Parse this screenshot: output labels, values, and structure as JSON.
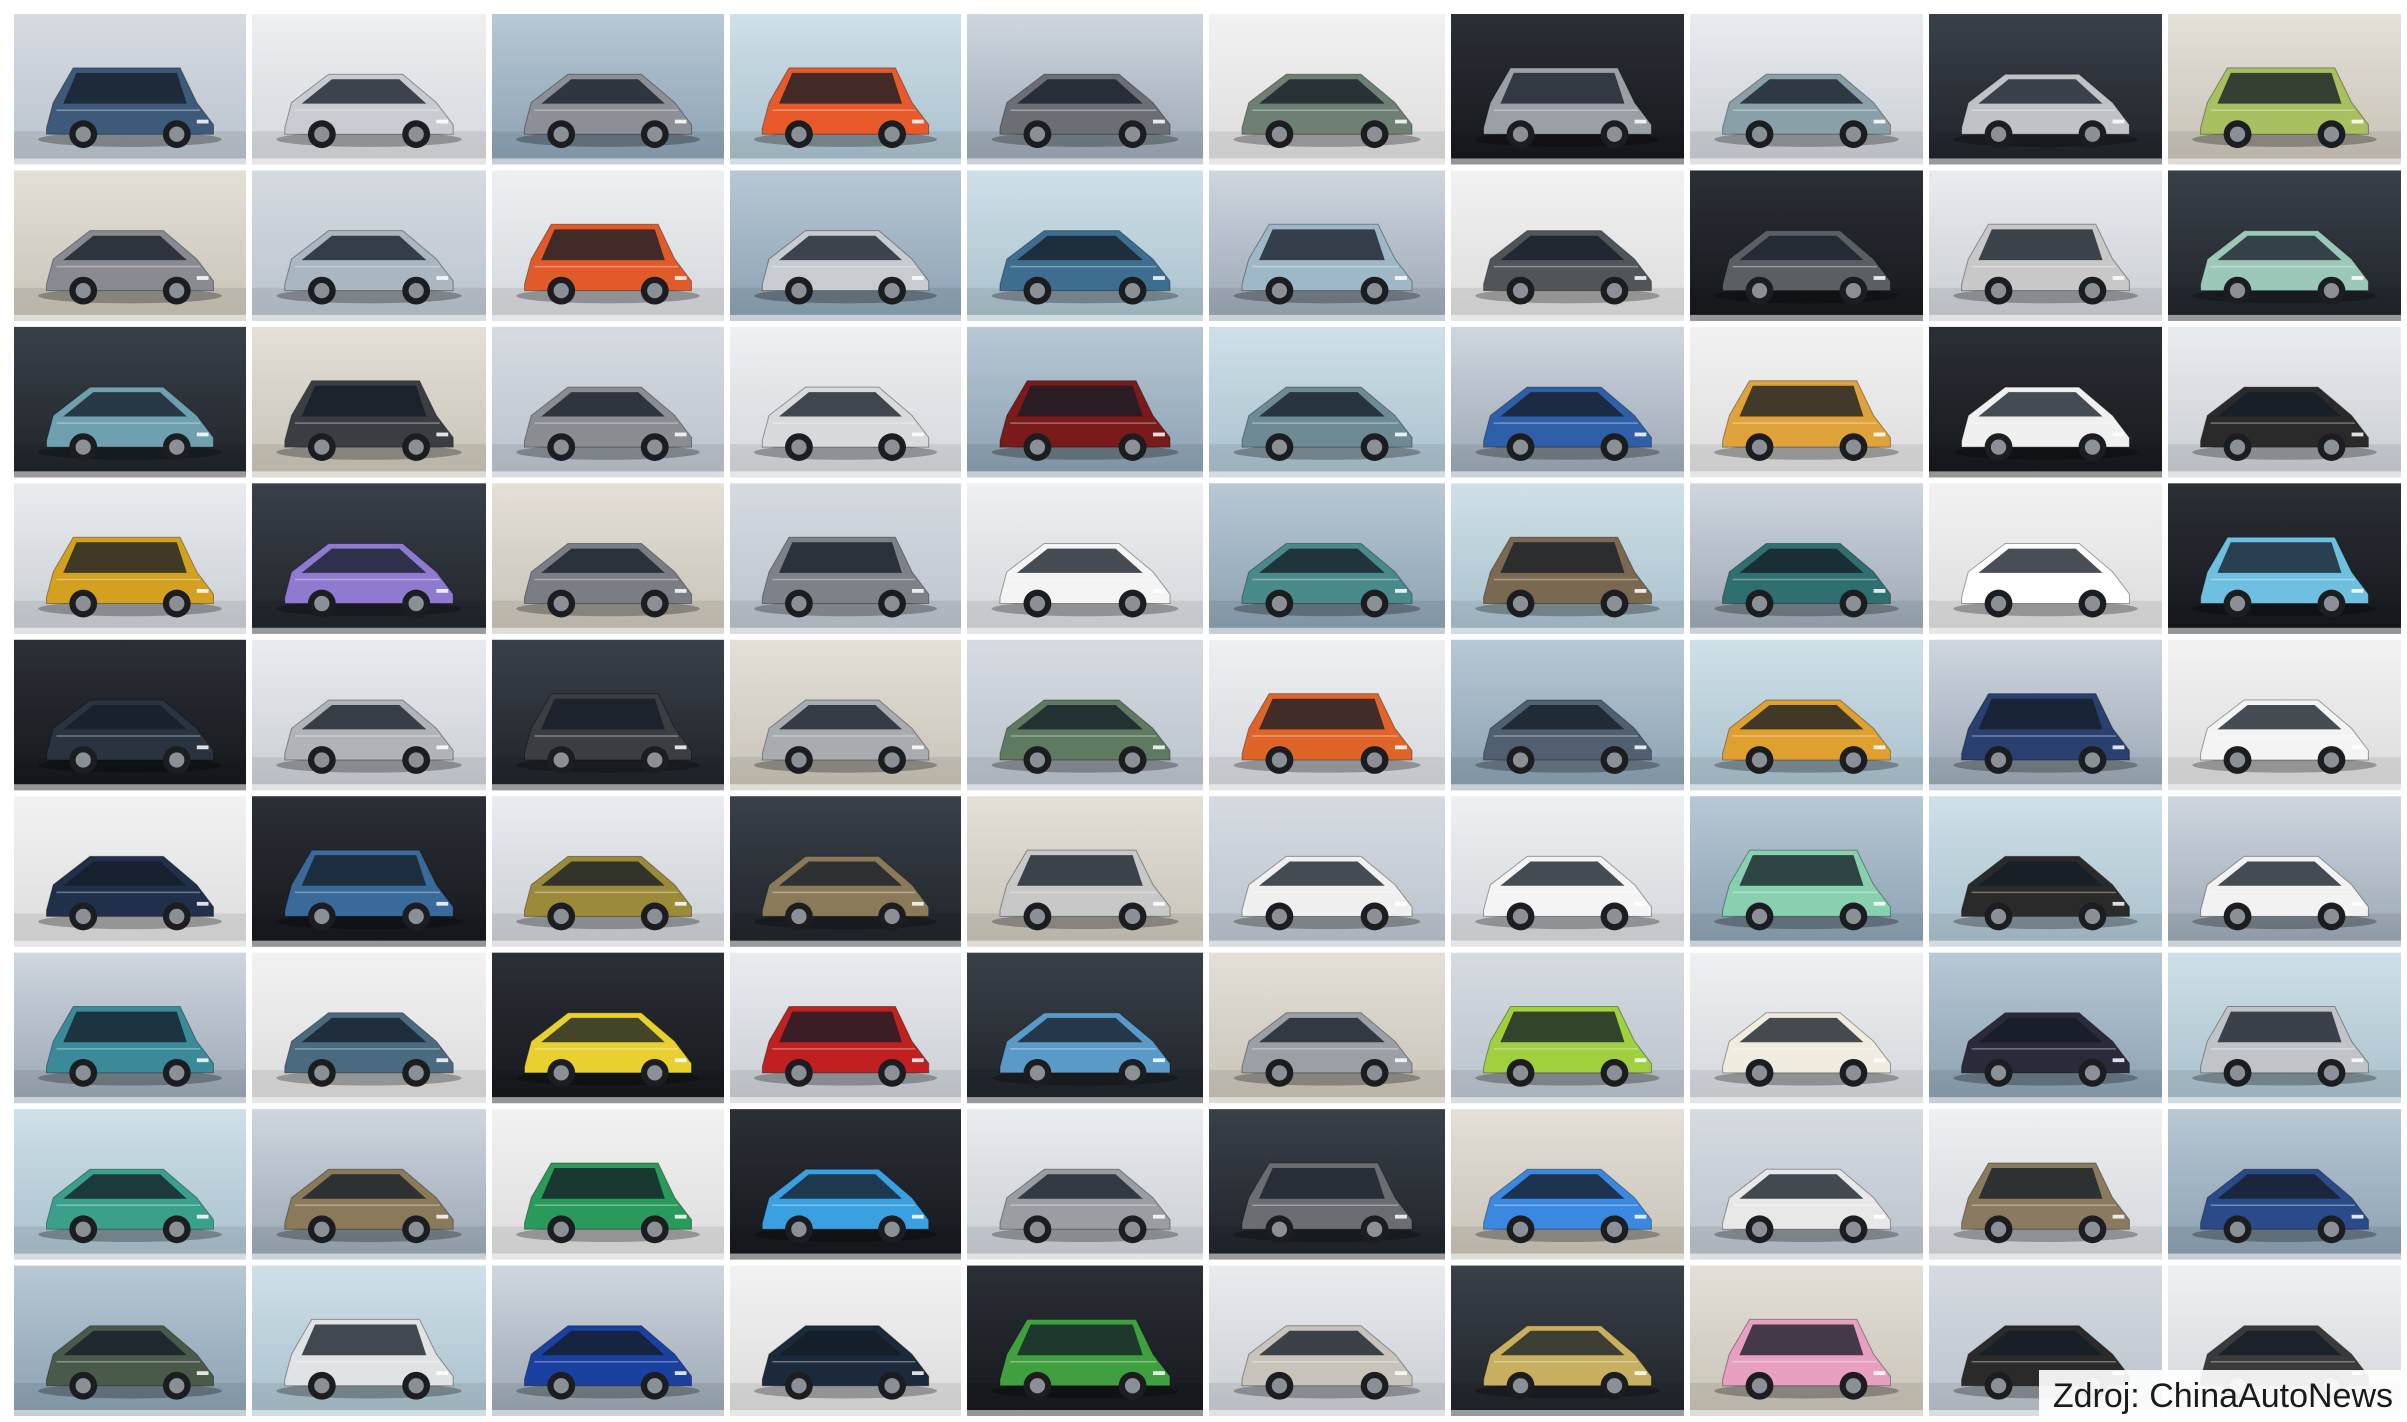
{
  "credit": {
    "text": "Zdroj: ChinaAutoNews"
  },
  "palette": {
    "page_background": "#ffffff",
    "divider": "#ffffff",
    "credit_background": "#ffffff",
    "credit_text": "#1a1a1a"
  },
  "photos": {
    "subject": "car-photo",
    "columns": 10,
    "rows": 9,
    "car_colors": [
      "#3d5a7a",
      "#c8ccd2",
      "#8c9096",
      "#e85a2a",
      "#6b6f75",
      "#6e7f73",
      "#9aa0a6",
      "#8aa0a8",
      "#bfc3c7",
      "#a8c060",
      "#8a8a92",
      "#aab6c0",
      "#e05a2a",
      "#c8ccd0",
      "#3d6d8f",
      "#9fb8c8",
      "#50555a",
      "#5a5f64",
      "#c8c8c8",
      "#9bc8b8",
      "#6fa0b0",
      "#3a3d42",
      "#8a8d92",
      "#d8dadc",
      "#7a1a1a",
      "#6d8a95",
      "#2f5fa8",
      "#e0a23a",
      "#f0f0f0",
      "#2a2a2a",
      "#d4a020",
      "#8f7ad0",
      "#7a7e84",
      "#7d8288",
      "#f4f4f4",
      "#4a8a8a",
      "#7a6850",
      "#2f6f6f",
      "#ffffff",
      "#6fc0e0",
      "#2a3440",
      "#b0b4b8",
      "#3a3d42",
      "#a8acb0",
      "#5e7a60",
      "#e0642a",
      "#506070",
      "#e0a030",
      "#2a4070",
      "#f4f4f4",
      "#20304a",
      "#3a6a9a",
      "#9a8a3a",
      "#8a7a5a",
      "#c8c8c8",
      "#f0f0f0",
      "#f4f4f4",
      "#88d0b0",
      "#2a2a2a",
      "#f2f2f2",
      "#3a8a9a",
      "#4a6a80",
      "#e8d030",
      "#c02020",
      "#5a9ac8",
      "#9aa0a6",
      "#a0d040",
      "#f0ece0",
      "#2a2a3a",
      "#c0c4c8",
      "#3aa08a",
      "#8a7a5a",
      "#2a9a5a",
      "#3aa0e0",
      "#9a9ea2",
      "#6a6e72",
      "#3a88e0",
      "#e8e8e8",
      "#8a7a60",
      "#2a4a8a",
      "#4a5a4a",
      "#e0e2e4",
      "#1a40a0",
      "#1a2a3a",
      "#40a040",
      "#c8c4bc",
      "#c8b060",
      "#e8a0c0",
      "#2a2a2a",
      "#3a3a3a"
    ]
  }
}
